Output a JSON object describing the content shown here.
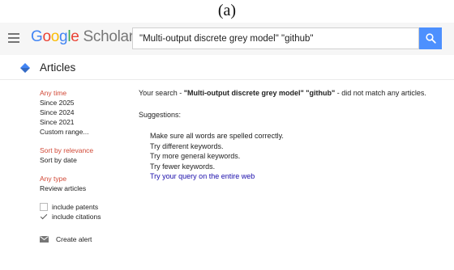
{
  "caption": "(a)",
  "header": {
    "logo": {
      "g1": "G",
      "g2": "o",
      "g3": "o",
      "g4": "g",
      "g5": "l",
      "g6": "e",
      "scholar": " Scholar"
    },
    "search_value": "\"Multi-output discrete grey model\" \"github\"",
    "menu_icon": "hamburger-menu-icon",
    "search_icon": "search-icon"
  },
  "subheader": {
    "label": "Articles",
    "icon": "articles-diamond-icon"
  },
  "sidebar": {
    "time": {
      "items": [
        {
          "label": "Any time",
          "active": true
        },
        {
          "label": "Since 2025",
          "active": false
        },
        {
          "label": "Since 2024",
          "active": false
        },
        {
          "label": "Since 2021",
          "active": false
        },
        {
          "label": "Custom range...",
          "active": false
        }
      ]
    },
    "sort": {
      "items": [
        {
          "label": "Sort by relevance",
          "active": true
        },
        {
          "label": "Sort by date",
          "active": false
        }
      ]
    },
    "type": {
      "items": [
        {
          "label": "Any type",
          "active": true
        },
        {
          "label": "Review articles",
          "active": false
        }
      ]
    },
    "include_patents": {
      "label": "include patents",
      "checked": false
    },
    "include_citations": {
      "label": "include citations",
      "checked": true
    },
    "create_alert": {
      "label": "Create alert",
      "icon": "envelope-icon"
    }
  },
  "main": {
    "message_prefix": "Your search - ",
    "message_query": "\"Multi-output discrete grey model\" \"github\"",
    "message_suffix": " - did not match any articles.",
    "suggestions_title": "Suggestions:",
    "suggestions": [
      "Make sure all words are spelled correctly.",
      "Try different keywords.",
      "Try more general keywords.",
      "Try fewer keywords."
    ],
    "web_link": "Try your query on the entire web"
  },
  "colors": {
    "accent_red": "#d14836",
    "link_blue": "#1a0dab",
    "search_button": "#4d90fe",
    "header_bg": "#f6f6f6"
  }
}
